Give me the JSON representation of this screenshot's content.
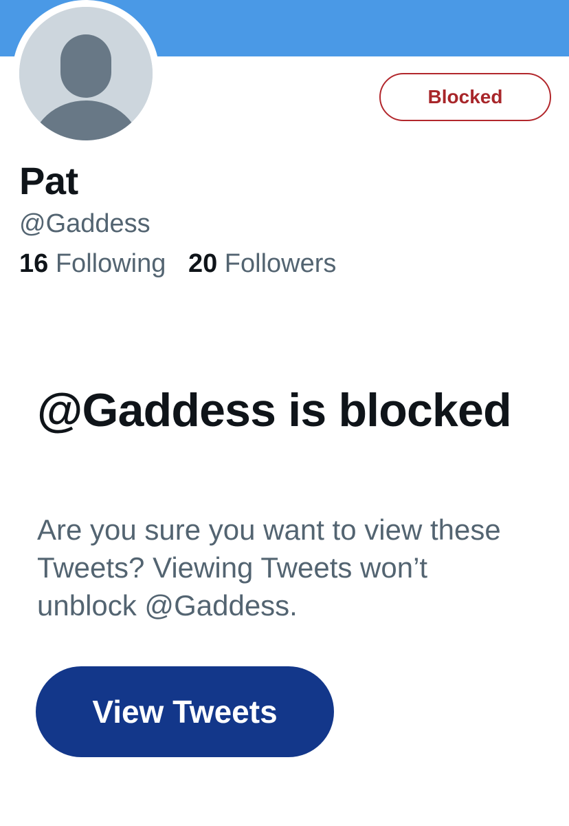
{
  "colors": {
    "banner": "#4a99e6",
    "blocked_accent": "#a8262a",
    "primary_button": "#13378a",
    "text_primary": "#0f1419",
    "text_secondary": "#536471"
  },
  "profile": {
    "avatar_icon": "default-avatar-icon",
    "name": "Pat",
    "handle": "@Gaddess",
    "following_count": "16",
    "following_label": "Following",
    "followers_count": "20",
    "followers_label": "Followers"
  },
  "actions": {
    "blocked_label": "Blocked"
  },
  "blocked_notice": {
    "title": "@Gaddess is blocked",
    "description": "Are you sure you want to view these Tweets? Viewing Tweets won’t unblock @Gaddess.",
    "view_button_label": "View Tweets"
  }
}
